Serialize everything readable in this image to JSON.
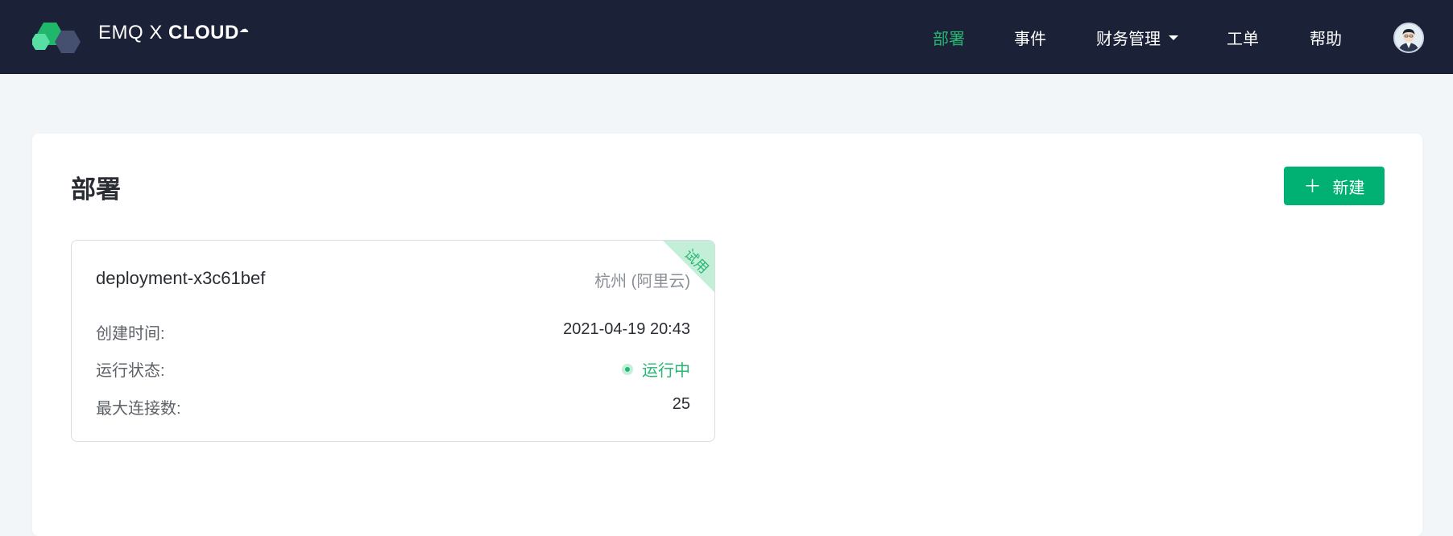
{
  "header": {
    "logo_text_light": "EMQ X ",
    "logo_text_bold": "CLOUD",
    "logo_cloud_mark": "☁",
    "nav": [
      {
        "label": "部署",
        "active": true
      },
      {
        "label": "事件",
        "active": false
      },
      {
        "label": "财务管理",
        "active": false,
        "has_dropdown": true
      },
      {
        "label": "工单",
        "active": false
      },
      {
        "label": "帮助",
        "active": false
      }
    ],
    "avatar_icon": "user-avatar"
  },
  "main": {
    "title": "部署",
    "new_button_icon": "＋",
    "new_button_label": "新建"
  },
  "deployment": {
    "name": "deployment-x3c61bef",
    "region": "杭州 (阿里云)",
    "badge": "试用",
    "rows": [
      {
        "label": "创建时间:",
        "value": "2021-04-19 20:43"
      },
      {
        "label": "运行状态:",
        "value": "运行中"
      },
      {
        "label": "最大连接数:",
        "value": "25"
      }
    ]
  },
  "colors": {
    "header_bg": "#1b2136",
    "accent": "#00b173",
    "active_nav": "#27b673",
    "page_bg": "#f3f6f8"
  }
}
